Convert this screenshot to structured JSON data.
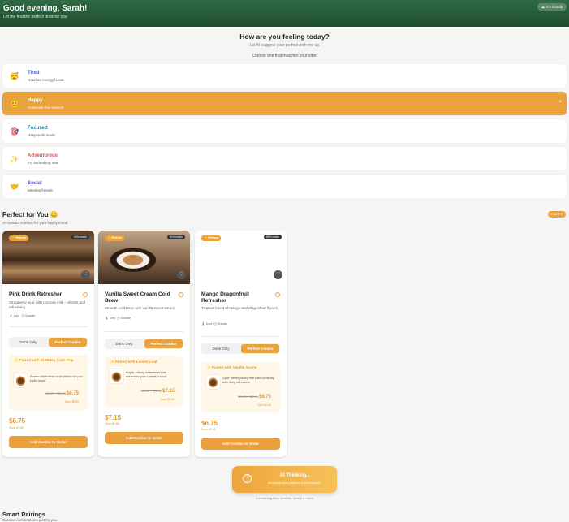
{
  "header": {
    "greeting": "Good evening, Sarah!",
    "subtitle": "Let me find the perfect drink for you",
    "weather": "It's cloudy",
    "weather_icon": "cloud-icon"
  },
  "mood_section": {
    "question": "How are you feeling today?",
    "helper": "Let AI suggest your perfect pick-me-up",
    "prompt": "Choose one that matches your vibe:",
    "close": "×"
  },
  "moods": [
    {
      "icon": "😴",
      "title": "Tired",
      "desc": "Need an energy boost",
      "color": "#3b5bdb",
      "selected": false
    },
    {
      "icon": "😊",
      "title": "Happy",
      "desc": "Celebrate the moment",
      "color": "#ffffff",
      "selected": true
    },
    {
      "icon": "🎯",
      "title": "Focused",
      "desc": "Deep work mode",
      "color": "#2f7a9b",
      "selected": false
    },
    {
      "icon": "✨",
      "title": "Adventurous",
      "desc": "Try something new",
      "color": "#d9534f",
      "selected": false
    },
    {
      "icon": "🤝",
      "title": "Social",
      "desc": "Meeting friends",
      "color": "#5b4fc2",
      "selected": false
    }
  ],
  "perfect": {
    "title": "Perfect for You 😊",
    "subtitle": "AI-curated combos for your happy mood",
    "pill": "HAPPY"
  },
  "cards": [
    {
      "badge": "⚡ Refresh",
      "tag": "94% match",
      "name": "Pink Drink Refresher",
      "desc": "Strawberry açaí with coconut milk – vibrant and refreshing",
      "cold": "Iced",
      "size": "Grande",
      "toggle_a": "Drink Only",
      "toggle_b": "Perfect Combo",
      "pair_title": "✨ Paired with Birthday Cake Pop",
      "pair_desc": "Sweet celebration treat perfect for your joyful mood",
      "old": "$4.65 + $2.95",
      "new": "$6.75",
      "pair_save": "Save $0.85",
      "price": "$6.75",
      "save": "Save $0.85",
      "cta": "Add Combo to Order"
    },
    {
      "badge": "⚡ Refresh",
      "tag": "91% match",
      "name": "Vanilla Sweet Cream Cold Brew",
      "desc": "Smooth cold brew with vanilla sweet cream",
      "cold": "Iced",
      "size": "Grande",
      "toggle_a": "Drink Only",
      "toggle_b": "Perfect Combo",
      "pair_title": "✨ Paired with Lemon Loaf",
      "pair_desc": "Bright, citrusy sweetness that enhances your cheerful mood",
      "old": "$4.95 + $3.05",
      "new": "$7.15",
      "pair_save": "Save $0.85",
      "price": "$7.15",
      "save": "Save $0.85",
      "cta": "Add Combo to Order"
    },
    {
      "badge": "⚡ Refresh",
      "tag": "88% match",
      "name": "Mango Dragonfruit Refresher",
      "desc": "Tropical blend of mango and dragonfruit flavors",
      "cold": "Iced",
      "size": "Grande",
      "toggle_a": "Drink Only",
      "toggle_b": "Perfect Combo",
      "pair_title": "✨ Paired with Vanilla Scone",
      "pair_desc": "Light, sweet pastry that pairs perfectly with fruity refreshers",
      "old": "$4.45 + $2.75",
      "new": "$6.75",
      "pair_save": "Save $0.45",
      "price": "$6.75",
      "save": "Save $0.45",
      "cta": "Add Combo to Order"
    }
  ],
  "ai": {
    "title": "AI Thinking...",
    "sub": "Analyzing your patterns & preferences...",
    "foot": "Considering time, weather, history & mood",
    "icon": "ⓘ"
  },
  "smart": {
    "title": "Smart Pairings",
    "subtitle": "Curated combinations just for you"
  }
}
